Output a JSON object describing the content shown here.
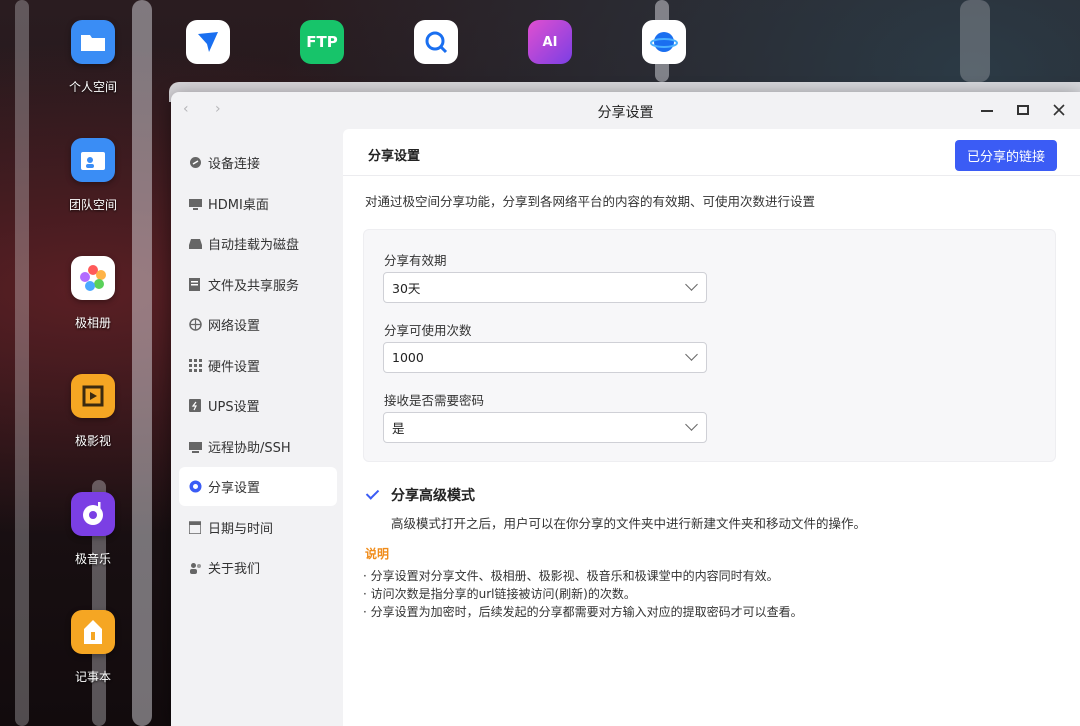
{
  "desktop": {
    "icons": [
      {
        "label": "个人空间",
        "icon": "folder-icon",
        "color": "#3a8df5"
      },
      {
        "label": "团队空间",
        "icon": "team-folder-icon",
        "color": "#3a8df5"
      },
      {
        "label": "极相册",
        "icon": "photos-icon",
        "color": "#ffffff"
      },
      {
        "label": "极影视",
        "icon": "video-icon",
        "color": "#f5a623"
      },
      {
        "label": "极音乐",
        "icon": "music-icon",
        "color": "#7b3fe4"
      },
      {
        "label": "记事本",
        "icon": "notepad-icon",
        "color": "#f5a623"
      }
    ],
    "top_icons": [
      {
        "icon": "thunder-download-icon",
        "color": "#ffffff",
        "glyph": ""
      },
      {
        "icon": "ftp-icon",
        "color": "#17c46a",
        "glyph": "FTP"
      },
      {
        "icon": "search-app-icon",
        "color": "#ffffff",
        "glyph": ""
      },
      {
        "icon": "ai-app-icon",
        "color": "#c03fe4",
        "glyph": "AI"
      },
      {
        "icon": "browser-globe-icon",
        "color": "#ffffff",
        "glyph": ""
      }
    ]
  },
  "window": {
    "title": "分享设置",
    "controls": {
      "back": "‹",
      "forward": "›",
      "minimize": "—",
      "maximize": "☐",
      "close": "✕"
    }
  },
  "sidebar": {
    "items": [
      {
        "label": "设备连接",
        "icon": "link-icon"
      },
      {
        "label": "HDMI桌面",
        "icon": "monitor-icon"
      },
      {
        "label": "自动挂载为磁盘",
        "icon": "disk-icon"
      },
      {
        "label": "文件及共享服务",
        "icon": "file-share-icon"
      },
      {
        "label": "网络设置",
        "icon": "globe-icon"
      },
      {
        "label": "硬件设置",
        "icon": "grid-icon"
      },
      {
        "label": "UPS设置",
        "icon": "ups-icon"
      },
      {
        "label": "远程协助/SSH",
        "icon": "terminal-icon"
      },
      {
        "label": "分享设置",
        "icon": "share-icon",
        "active": true
      },
      {
        "label": "日期与时间",
        "icon": "calendar-icon"
      },
      {
        "label": "关于我们",
        "icon": "users-icon"
      }
    ]
  },
  "content": {
    "header_title": "分享设置",
    "shared_links_button": "已分享的链接",
    "description": "对通过极空间分享功能，分享到各网络平台的内容的有效期、可使用次数进行设置",
    "fields": [
      {
        "label": "分享有效期",
        "value": "30天"
      },
      {
        "label": "分享可使用次数",
        "value": "1000"
      },
      {
        "label": "接收是否需要密码",
        "value": "是"
      }
    ],
    "advanced": {
      "checked": true,
      "title": "分享高级模式",
      "description": "高级模式打开之后，用户可以在你分享的文件夹中进行新建文件夹和移动文件的操作。"
    },
    "notes": {
      "title": "说明",
      "lines": [
        "· 分享设置对分享文件、极相册、极影视、极音乐和极课堂中的内容同时有效。",
        "· 访问次数是指分享的url链接被访问(刷新)的次数。",
        "· 分享设置为加密时，后续发起的分享都需要对方输入对应的提取密码才可以查看。"
      ]
    }
  },
  "colors": {
    "accent": "#3b5cf5",
    "note_title": "#f08c1a"
  }
}
